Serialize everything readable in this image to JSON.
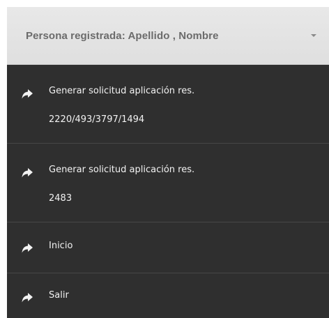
{
  "header": {
    "label": "Persona registrada: Apellido , Nombre"
  },
  "menu": {
    "items": [
      {
        "line1": "Generar solicitud aplicación res.",
        "line2": "2220/493/3797/1494",
        "icon": "share-arrow-icon"
      },
      {
        "line1": "Generar solicitud aplicación res.",
        "line2": "2483",
        "icon": "share-arrow-icon"
      },
      {
        "line1": "Inicio",
        "icon": "share-arrow-icon"
      },
      {
        "line1": "Salir",
        "icon": "share-arrow-icon"
      }
    ]
  },
  "colors": {
    "header_bg": "#e4e4e4",
    "header_text": "#6b6b6b",
    "menu_bg": "#2f2f2f",
    "menu_text": "#f2f2f2",
    "divider": "#474747"
  }
}
